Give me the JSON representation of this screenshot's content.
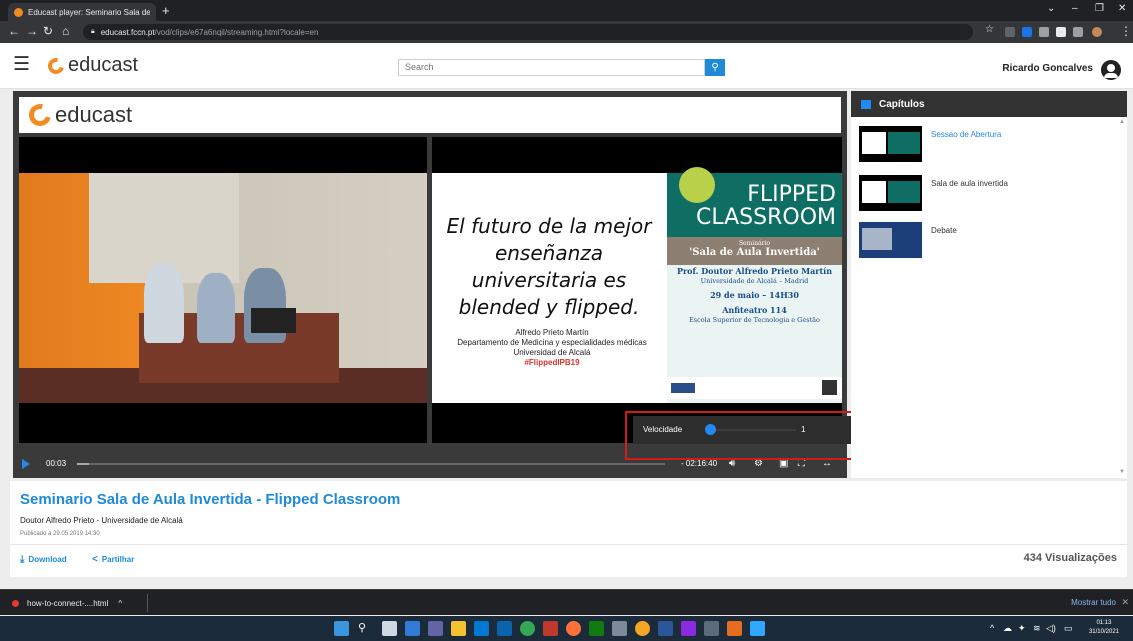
{
  "browser": {
    "tab_title": "Educast player: Seminario Sala de ×",
    "tab_close": "×",
    "new_tab": "+",
    "url_domain": "educast.fccn.pt",
    "url_path": "/vod/clips/e67a6nqil/streaming.html?locale=en",
    "win_min": "⌄",
    "win_min2": "–",
    "win_restore": "❐",
    "win_close": "✕"
  },
  "site": {
    "logo": "educast",
    "search_placeholder": "Search",
    "search_icon": "search-icon",
    "user_name": "Ricardo Goncalves"
  },
  "player": {
    "logo": "educast",
    "slide_text": "El futuro de la mejor enseñanza universitaria es blended y flipped.",
    "slide_author": "Alfredo Prieto Martín",
    "slide_dept": "Departamento de Medicina y especialidades médicas",
    "slide_univ": "Universidad de Alcalá",
    "slide_tag": "#FlippedIPB19",
    "poster_title1": "FLIPPED",
    "poster_title2": "CLASSROOM",
    "poster_seminar": "Seminário",
    "poster_room": "'Sala de Aula Invertida'",
    "poster_prof": "Prof. Doutor Alfredo Prieto Martín",
    "poster_univ": "Universidade de Alcalá – Madrid",
    "poster_date": "29 de maio – 14H30",
    "poster_place": "Anfiteatro 114",
    "poster_school": "Escola Superior de Tecnologia e Gestão",
    "current_time": "00:03",
    "duration": "- 02:16:40",
    "progress": 0.02,
    "speed_label": "Velocidade",
    "speed_value": "1"
  },
  "chapters": {
    "title": "Capítulos",
    "items": [
      {
        "label": "Sessao de Abertura",
        "active": true
      },
      {
        "label": "Sala de aula invertida",
        "active": false
      },
      {
        "label": "Debate",
        "active": false
      }
    ]
  },
  "info": {
    "title": "Seminario Sala de Aula Invertida - Flipped Classroom",
    "subtitle": "Doutor Alfredo Prieto - Universidade de Alcalá",
    "published": "Publicado a 29.05.2019 14:30",
    "download": "Download",
    "share": "Partilhar",
    "views": "434 Visualizações"
  },
  "downloads": {
    "file": "how-to-connect-....html",
    "chevron": "^",
    "show_all": "Mostrar tudo",
    "close": "✕"
  },
  "taskbar": {
    "time": "01:13",
    "date": "31/10/2021"
  },
  "colors": {
    "accent": "#1f8ad8",
    "brand_orange": "#f28b20",
    "highlight_frame": "#d01c1c"
  }
}
